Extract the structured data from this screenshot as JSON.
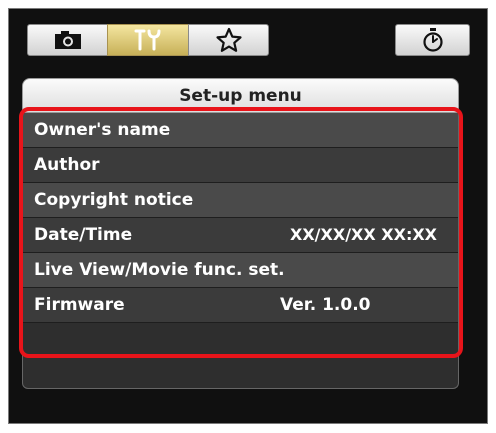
{
  "tabs": [
    {
      "id": "camera",
      "icon": "camera-icon",
      "active": false
    },
    {
      "id": "setup",
      "icon": "wrench-tools-icon",
      "active": true
    },
    {
      "id": "mymenu",
      "icon": "star-outline-icon",
      "active": false
    },
    {
      "id": "timer",
      "icon": "stopwatch-icon",
      "active": false
    }
  ],
  "menu": {
    "title": "Set-up menu",
    "items": [
      {
        "label": "Owner's name",
        "value": ""
      },
      {
        "label": "Author",
        "value": ""
      },
      {
        "label": "Copyright notice",
        "value": ""
      },
      {
        "label": "Date/Time",
        "value": "XX/XX/XX XX:XX"
      },
      {
        "label": "Live View/Movie func. set.",
        "value": ""
      },
      {
        "label": "Firmware",
        "value": "Ver. 1.0.0"
      }
    ]
  },
  "colors": {
    "highlight_border": "#e8141a",
    "active_tab": "#e8d486",
    "row_odd": "#4a4a4a",
    "row_even": "#3b3b3b"
  }
}
